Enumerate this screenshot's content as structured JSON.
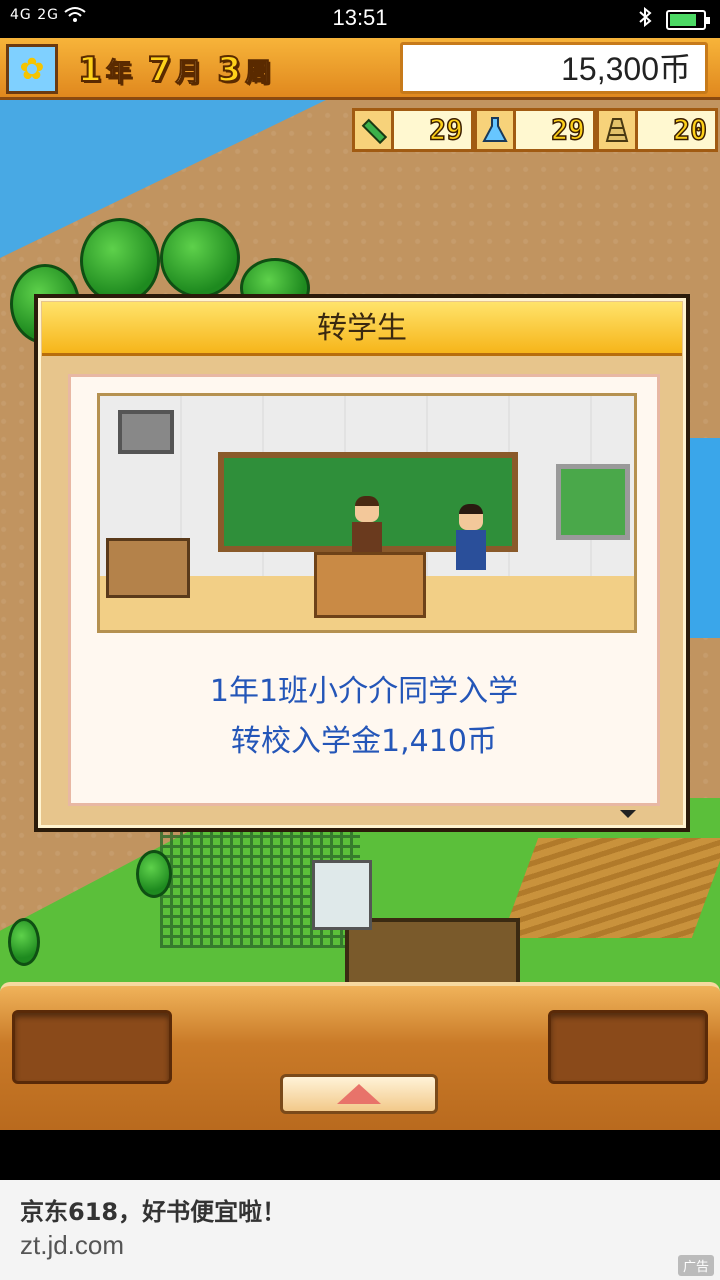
{
  "status_bar": {
    "network": "4G 2G",
    "time": "13:51",
    "battery_level": 0.8
  },
  "top_bar": {
    "year_num": "1",
    "year_unit": "年",
    "month_num": "7",
    "month_unit": "月",
    "week_num": "3",
    "week_unit": "周",
    "money": "15,300币"
  },
  "stats": [
    {
      "icon": "pencil-icon",
      "value": "29"
    },
    {
      "icon": "flask-icon",
      "value": "29"
    },
    {
      "icon": "cone-icon",
      "value": "20"
    }
  ],
  "dialog": {
    "title": "转学生",
    "line1": "1年1班小介介同学入学",
    "line2": "转校入学金1,410币"
  },
  "ad": {
    "title": "京东618，好书便宜啦！",
    "url": "zt.jd.com",
    "badge": "广告"
  },
  "colors": {
    "accent_orange": "#f6b51a",
    "message_blue": "#2456b8",
    "money_text": "#222222"
  }
}
